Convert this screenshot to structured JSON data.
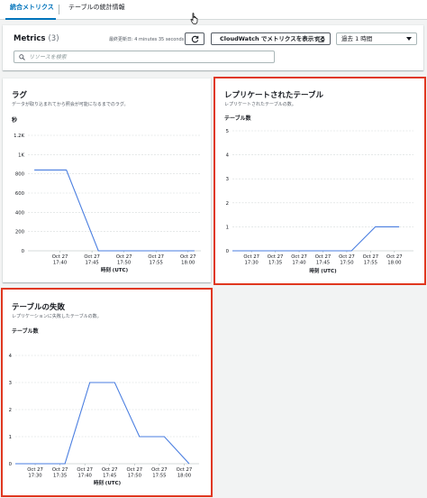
{
  "tabs": [
    {
      "label": "統合メトリクス",
      "active": true
    },
    {
      "label": "テーブルの統計情報",
      "active": false
    }
  ],
  "metrics": {
    "title": "Metrics",
    "count": "(3)",
    "last_updated": "最終更新日: 4 minutes 35 seconds",
    "refresh_icon": "refresh-icon",
    "cloudwatch_button": "CloudWatch でメトリクスを表示する",
    "external_icon": "external-link-icon",
    "time_range": "過去 1 時間",
    "search_placeholder": "リソースを検索"
  },
  "colors": {
    "line": "#4a7ee0",
    "highlight_border": "#e0371f",
    "grid": "#d5dbdb",
    "accent": "#0073bb"
  },
  "chart_data": [
    {
      "type": "line",
      "title": "ラグ",
      "subtitle": "データが取り込まれてから照会が可能になるまでのラグ。",
      "ylabel": "秒",
      "xlabel": "時刻 (UTC)",
      "y_ticks": [
        "0",
        "200",
        "400",
        "600",
        "800",
        "1K",
        "1.2K"
      ],
      "ylim": [
        0,
        1200
      ],
      "x_ticks": [
        "Oct 27\n17:40",
        "Oct 27\n17:45",
        "Oct 27\n17:50",
        "Oct 27\n17:55",
        "Oct 27\n18:00"
      ],
      "x_tick_minutes": [
        1060,
        1065,
        1070,
        1075,
        1080
      ],
      "xlim_minutes": [
        1055,
        1082
      ],
      "x": [
        "17:36",
        "17:41",
        "17:46",
        "17:51",
        "17:56",
        "18:01"
      ],
      "x_minutes": [
        1056,
        1061,
        1066,
        1071,
        1076,
        1081
      ],
      "values": [
        840,
        840,
        0,
        0,
        0,
        0
      ],
      "highlighted": false
    },
    {
      "type": "line",
      "title": "レプリケートされたテーブル",
      "subtitle": "レプリケートされたテーブルの数。",
      "ylabel": "テーブル数",
      "xlabel": "時刻 (UTC)",
      "y_ticks": [
        "0",
        "1",
        "2",
        "3",
        "4",
        "5"
      ],
      "ylim": [
        0,
        5
      ],
      "x_ticks": [
        "Oct 27\n17:30",
        "Oct 27\n17:35",
        "Oct 27\n17:40",
        "Oct 27\n17:45",
        "Oct 27\n17:50",
        "Oct 27\n17:55",
        "Oct 27\n18:00"
      ],
      "x_tick_minutes": [
        1050,
        1055,
        1060,
        1065,
        1070,
        1075,
        1080
      ],
      "xlim_minutes": [
        1046,
        1084
      ],
      "x": [
        "17:26",
        "17:51",
        "17:56",
        "18:01"
      ],
      "x_minutes": [
        1046,
        1071,
        1076,
        1081
      ],
      "values": [
        0,
        0,
        1,
        1
      ],
      "highlighted": true
    },
    {
      "type": "line",
      "title": "テーブルの失敗",
      "subtitle": "レプリケーションに失敗したテーブルの数。",
      "ylabel": "テーブル数",
      "xlabel": "時刻 (UTC)",
      "y_ticks": [
        "0",
        "1",
        "2",
        "3",
        "4"
      ],
      "ylim": [
        0,
        4
      ],
      "x_ticks": [
        "Oct 27\n17:30",
        "Oct 27\n17:35",
        "Oct 27\n17:40",
        "Oct 27\n17:45",
        "Oct 27\n17:50",
        "Oct 27\n17:55",
        "Oct 27\n18:00"
      ],
      "x_tick_minutes": [
        1050,
        1055,
        1060,
        1065,
        1070,
        1075,
        1080
      ],
      "xlim_minutes": [
        1046,
        1083
      ],
      "x": [
        "17:26",
        "17:36",
        "17:41",
        "17:46",
        "17:51",
        "17:56",
        "18:01"
      ],
      "x_minutes": [
        1046,
        1056,
        1061,
        1066,
        1071,
        1076,
        1081
      ],
      "values": [
        0,
        0,
        3,
        3,
        1,
        1,
        0
      ],
      "highlighted": true
    }
  ]
}
